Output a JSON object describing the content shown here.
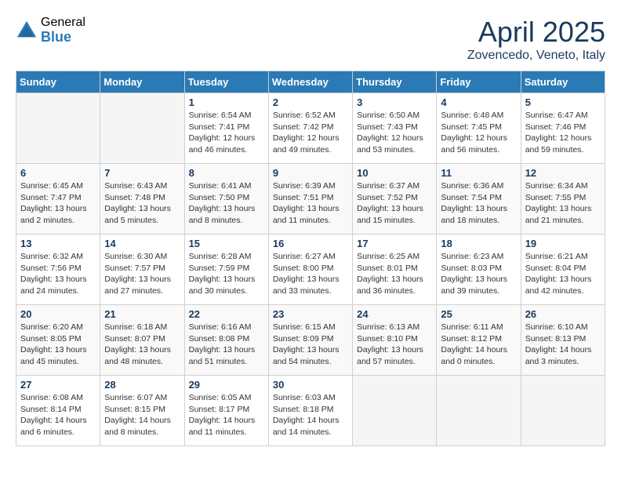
{
  "logo": {
    "general": "General",
    "blue": "Blue"
  },
  "header": {
    "month": "April 2025",
    "location": "Zovencedo, Veneto, Italy"
  },
  "weekdays": [
    "Sunday",
    "Monday",
    "Tuesday",
    "Wednesday",
    "Thursday",
    "Friday",
    "Saturday"
  ],
  "weeks": [
    [
      {
        "day": "",
        "empty": true
      },
      {
        "day": "",
        "empty": true
      },
      {
        "day": "1",
        "sunrise": "6:54 AM",
        "sunset": "7:41 PM",
        "daylight": "12 hours and 46 minutes."
      },
      {
        "day": "2",
        "sunrise": "6:52 AM",
        "sunset": "7:42 PM",
        "daylight": "12 hours and 49 minutes."
      },
      {
        "day": "3",
        "sunrise": "6:50 AM",
        "sunset": "7:43 PM",
        "daylight": "12 hours and 53 minutes."
      },
      {
        "day": "4",
        "sunrise": "6:48 AM",
        "sunset": "7:45 PM",
        "daylight": "12 hours and 56 minutes."
      },
      {
        "day": "5",
        "sunrise": "6:47 AM",
        "sunset": "7:46 PM",
        "daylight": "12 hours and 59 minutes."
      }
    ],
    [
      {
        "day": "6",
        "sunrise": "6:45 AM",
        "sunset": "7:47 PM",
        "daylight": "13 hours and 2 minutes."
      },
      {
        "day": "7",
        "sunrise": "6:43 AM",
        "sunset": "7:48 PM",
        "daylight": "13 hours and 5 minutes."
      },
      {
        "day": "8",
        "sunrise": "6:41 AM",
        "sunset": "7:50 PM",
        "daylight": "13 hours and 8 minutes."
      },
      {
        "day": "9",
        "sunrise": "6:39 AM",
        "sunset": "7:51 PM",
        "daylight": "13 hours and 11 minutes."
      },
      {
        "day": "10",
        "sunrise": "6:37 AM",
        "sunset": "7:52 PM",
        "daylight": "13 hours and 15 minutes."
      },
      {
        "day": "11",
        "sunrise": "6:36 AM",
        "sunset": "7:54 PM",
        "daylight": "13 hours and 18 minutes."
      },
      {
        "day": "12",
        "sunrise": "6:34 AM",
        "sunset": "7:55 PM",
        "daylight": "13 hours and 21 minutes."
      }
    ],
    [
      {
        "day": "13",
        "sunrise": "6:32 AM",
        "sunset": "7:56 PM",
        "daylight": "13 hours and 24 minutes."
      },
      {
        "day": "14",
        "sunrise": "6:30 AM",
        "sunset": "7:57 PM",
        "daylight": "13 hours and 27 minutes."
      },
      {
        "day": "15",
        "sunrise": "6:28 AM",
        "sunset": "7:59 PM",
        "daylight": "13 hours and 30 minutes."
      },
      {
        "day": "16",
        "sunrise": "6:27 AM",
        "sunset": "8:00 PM",
        "daylight": "13 hours and 33 minutes."
      },
      {
        "day": "17",
        "sunrise": "6:25 AM",
        "sunset": "8:01 PM",
        "daylight": "13 hours and 36 minutes."
      },
      {
        "day": "18",
        "sunrise": "6:23 AM",
        "sunset": "8:03 PM",
        "daylight": "13 hours and 39 minutes."
      },
      {
        "day": "19",
        "sunrise": "6:21 AM",
        "sunset": "8:04 PM",
        "daylight": "13 hours and 42 minutes."
      }
    ],
    [
      {
        "day": "20",
        "sunrise": "6:20 AM",
        "sunset": "8:05 PM",
        "daylight": "13 hours and 45 minutes."
      },
      {
        "day": "21",
        "sunrise": "6:18 AM",
        "sunset": "8:07 PM",
        "daylight": "13 hours and 48 minutes."
      },
      {
        "day": "22",
        "sunrise": "6:16 AM",
        "sunset": "8:08 PM",
        "daylight": "13 hours and 51 minutes."
      },
      {
        "day": "23",
        "sunrise": "6:15 AM",
        "sunset": "8:09 PM",
        "daylight": "13 hours and 54 minutes."
      },
      {
        "day": "24",
        "sunrise": "6:13 AM",
        "sunset": "8:10 PM",
        "daylight": "13 hours and 57 minutes."
      },
      {
        "day": "25",
        "sunrise": "6:11 AM",
        "sunset": "8:12 PM",
        "daylight": "14 hours and 0 minutes."
      },
      {
        "day": "26",
        "sunrise": "6:10 AM",
        "sunset": "8:13 PM",
        "daylight": "14 hours and 3 minutes."
      }
    ],
    [
      {
        "day": "27",
        "sunrise": "6:08 AM",
        "sunset": "8:14 PM",
        "daylight": "14 hours and 6 minutes."
      },
      {
        "day": "28",
        "sunrise": "6:07 AM",
        "sunset": "8:15 PM",
        "daylight": "14 hours and 8 minutes."
      },
      {
        "day": "29",
        "sunrise": "6:05 AM",
        "sunset": "8:17 PM",
        "daylight": "14 hours and 11 minutes."
      },
      {
        "day": "30",
        "sunrise": "6:03 AM",
        "sunset": "8:18 PM",
        "daylight": "14 hours and 14 minutes."
      },
      {
        "day": "",
        "empty": true
      },
      {
        "day": "",
        "empty": true
      },
      {
        "day": "",
        "empty": true
      }
    ]
  ]
}
